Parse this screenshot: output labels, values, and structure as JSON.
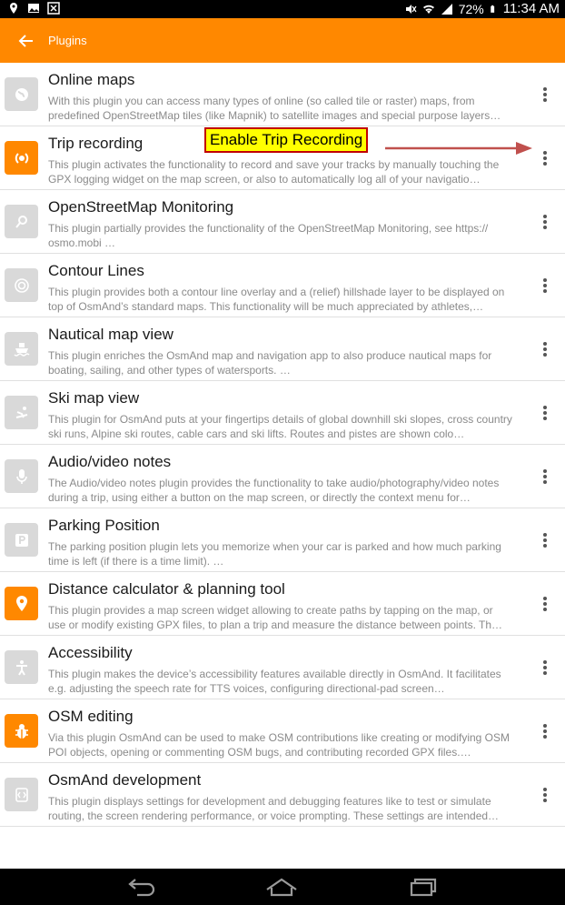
{
  "status": {
    "battery": "72%",
    "time": "11:34 AM",
    "icons_left": [
      "location-icon",
      "gallery-icon",
      "excel-icon"
    ],
    "icons_right": [
      "mute-icon",
      "wifi-icon",
      "signal-icon",
      "battery-icon"
    ]
  },
  "appbar": {
    "title": "Plugins",
    "back_icon": "back-arrow-icon"
  },
  "colors": {
    "accent": "#ff8800",
    "inactive_icon": "#d9d9d9",
    "callout_bg": "#ffff00",
    "callout_border": "#c00000",
    "arrow": "#c0504d"
  },
  "callout": {
    "text": "Enable Trip Recording"
  },
  "plugins": [
    {
      "name": "Online maps",
      "enabled": false,
      "icon": "globe-icon",
      "desc": "With this plugin you can access many types of online (so called tile or raster) maps, from predefined OpenStreetMap tiles (like Mapnik) to satellite images and special purpose layers…"
    },
    {
      "name": "Trip recording",
      "enabled": true,
      "icon": "trip-recording-icon",
      "desc": "This plugin activates the functionality to record and save your tracks by manually touching the GPX logging widget on the map screen, or also to automatically log all of your navigatio…"
    },
    {
      "name": "OpenStreetMap Monitoring",
      "enabled": false,
      "icon": "monitoring-icon",
      "desc": "This plugin partially provides the functionality of the OpenStreetMap Monitoring, see https:// osmo.mobi …"
    },
    {
      "name": "Contour Lines",
      "enabled": false,
      "icon": "contour-icon",
      "desc": "This plugin provides both a contour line overlay and a (relief) hillshade layer to be displayed on top of OsmAnd’s standard maps. This functionality will be much appreciated by athletes,…"
    },
    {
      "name": "Nautical map view",
      "enabled": false,
      "icon": "ship-icon",
      "desc": "This plugin enriches the OsmAnd map and navigation app to also produce nautical maps for boating, sailing, and other types of watersports. …"
    },
    {
      "name": "Ski map view",
      "enabled": false,
      "icon": "skier-icon",
      "desc": "This plugin for OsmAnd puts at your fingertips details of global downhill ski slopes, cross country ski runs, Alpine ski routes, cable cars and ski lifts. Routes and pistes are shown colo…"
    },
    {
      "name": "Audio/video notes",
      "enabled": false,
      "icon": "microphone-icon",
      "desc": "The Audio/video notes plugin provides the functionality to take audio/photography/video notes during a trip, using either a button on the map screen, or directly the context menu for…"
    },
    {
      "name": "Parking Position",
      "enabled": false,
      "icon": "parking-icon",
      "desc": "The parking position plugin lets you memorize when your car is parked and how much parking time is left (if there is a time limit). …"
    },
    {
      "name": "Distance calculator & planning tool",
      "enabled": true,
      "icon": "map-pin-icon",
      "desc": "This plugin provides a map screen widget allowing to create paths by tapping on the map, or use or modify existing GPX files, to plan a trip and measure the distance between points. Th…"
    },
    {
      "name": "Accessibility",
      "enabled": false,
      "icon": "accessibility-icon",
      "desc": "This plugin makes the device’s accessibility features available directly in OsmAnd. It facilitates e.g. adjusting the speech rate for TTS voices, configuring directional-pad screen…"
    },
    {
      "name": "OSM editing",
      "enabled": true,
      "icon": "bug-icon",
      "desc": "Via this plugin OsmAnd can be used to make OSM contributions like creating or modifying OSM POI objects, opening or commenting OSM bugs, and contributing recorded GPX files.…"
    },
    {
      "name": "OsmAnd development",
      "enabled": false,
      "icon": "development-icon",
      "desc": "This plugin displays settings for development and debugging features like to test or simulate routing, the screen rendering performance, or voice prompting. These settings are intended…"
    }
  ],
  "navbar": {
    "icons": [
      "nav-back-icon",
      "nav-home-icon",
      "nav-recents-icon"
    ]
  }
}
